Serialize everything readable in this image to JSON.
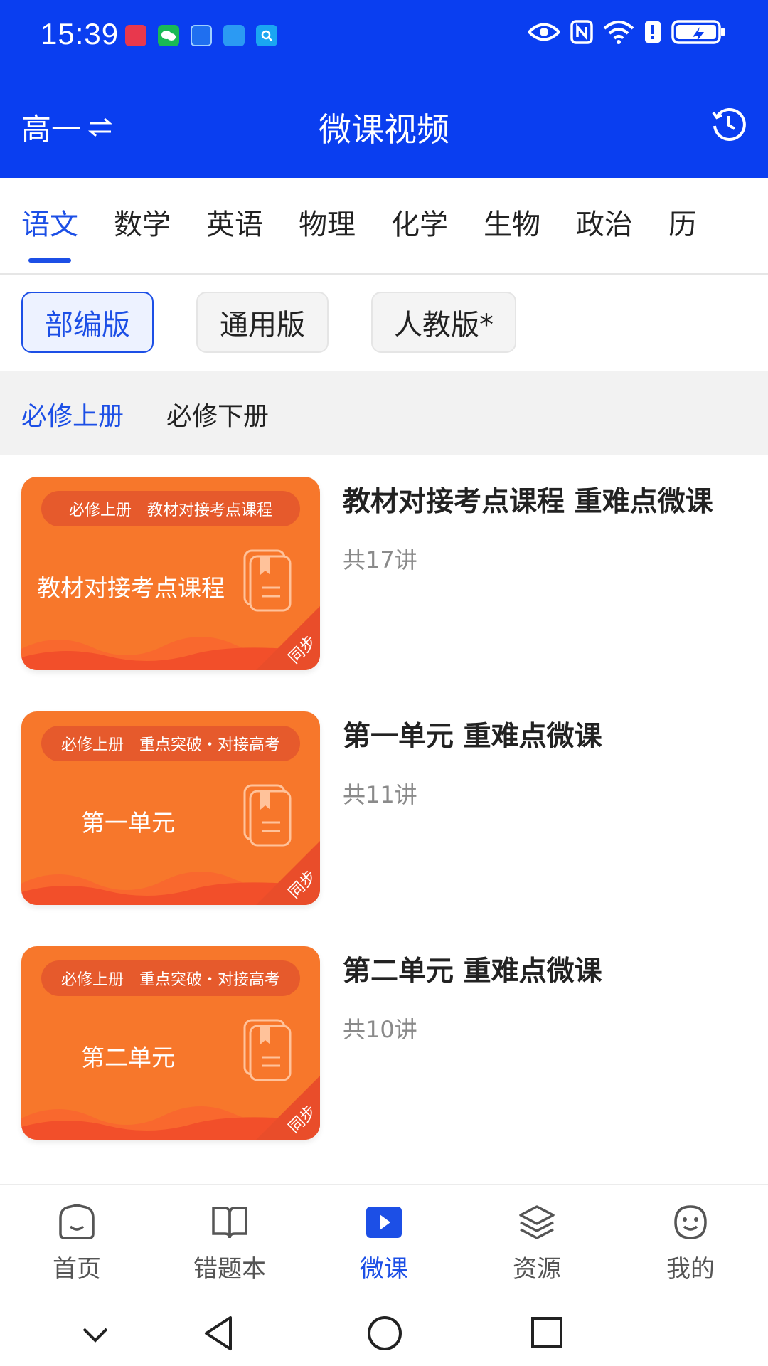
{
  "status_bar": {
    "time": "15:39",
    "notification_icons": [
      "huawei-app-icon",
      "wechat-icon",
      "gallery-app-icon",
      "cloud-app-icon",
      "search-app-icon"
    ],
    "system_icons": [
      "eye-icon",
      "nfc-icon",
      "wifi-icon",
      "alert-icon",
      "battery-charging-icon"
    ]
  },
  "header": {
    "grade_label": "高一",
    "swap_icon": "swap-icon",
    "title": "微课视频",
    "history_icon": "history-clock-icon",
    "background": "#0a3ef0"
  },
  "subject_tabs": [
    "语文",
    "数学",
    "英语",
    "物理",
    "化学",
    "生物",
    "政治",
    "历"
  ],
  "active_subject_index": 0,
  "editions": [
    "部编版",
    "通用版",
    "人教版*"
  ],
  "active_edition_index": 0,
  "volumes": [
    "必修上册",
    "必修下册"
  ],
  "active_volume_index": 0,
  "courses": [
    {
      "thumb_tag_left": "必修上册",
      "thumb_tag_right": "教材对接考点课程",
      "thumb_title": "教材对接考点课程",
      "thumb_corner": "同步",
      "title": "教材对接考点课程 重难点微课",
      "count": "共17讲"
    },
    {
      "thumb_tag_left": "必修上册",
      "thumb_tag_right": "重点突破・对接高考",
      "thumb_title": "第一单元",
      "thumb_corner": "同步",
      "title": "第一单元 重难点微课",
      "count": "共11讲"
    },
    {
      "thumb_tag_left": "必修上册",
      "thumb_tag_right": "重点突破・对接高考",
      "thumb_title": "第二单元",
      "thumb_corner": "同步",
      "title": "第二单元 重难点微课",
      "count": "共10讲"
    }
  ],
  "bottom_nav": [
    {
      "label": "首页",
      "icon": "home-icon"
    },
    {
      "label": "错题本",
      "icon": "book-icon"
    },
    {
      "label": "微课",
      "icon": "play-icon"
    },
    {
      "label": "资源",
      "icon": "layers-icon"
    },
    {
      "label": "我的",
      "icon": "smiley-icon"
    }
  ],
  "active_nav_index": 2,
  "colors": {
    "accent": "#1c4fe6",
    "thumb_orange": "#f7772b"
  }
}
